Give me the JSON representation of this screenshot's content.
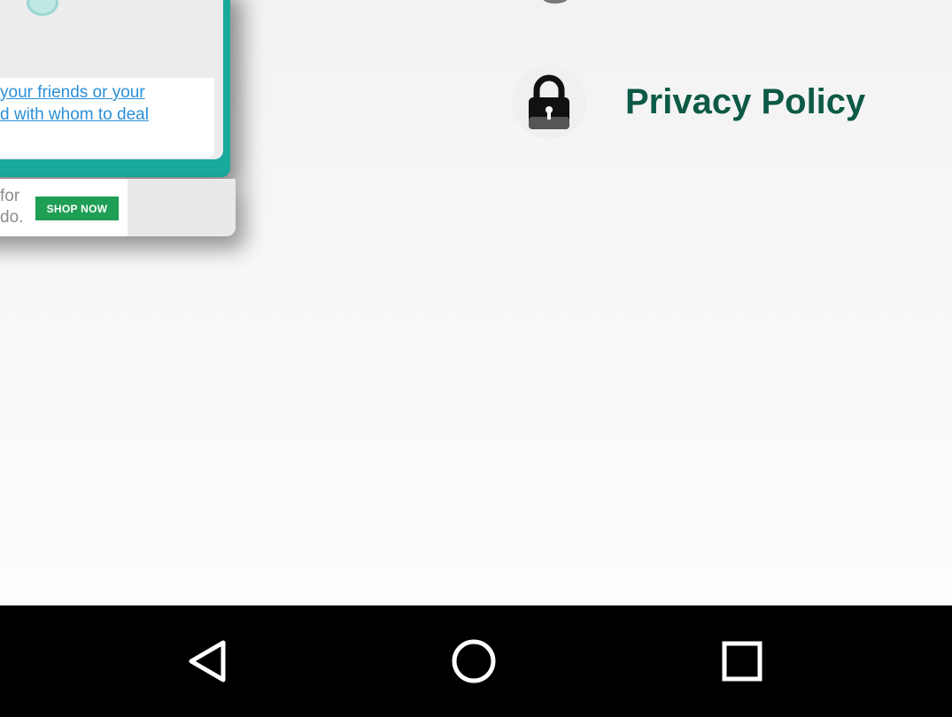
{
  "overlay_card": {
    "link_text_line1": "your friends or your",
    "link_text_line2": "d with whom to deal",
    "ad_text_line1": "for",
    "ad_text_line2": "do.",
    "shop_button_label": "SHOP NOW"
  },
  "menu": {
    "privacy_policy_label": "Privacy Policy",
    "privacy_policy_icon": "lock-icon"
  },
  "navigation_bar": {
    "back_icon": "back-triangle-icon",
    "home_icon": "home-circle-icon",
    "recents_icon": "recents-square-icon"
  },
  "colors": {
    "teal": "#1aa99d",
    "menu_text": "#0d5a46",
    "link": "#2a8fd6",
    "shop_button": "#1f9f55",
    "navbar": "#000000"
  }
}
